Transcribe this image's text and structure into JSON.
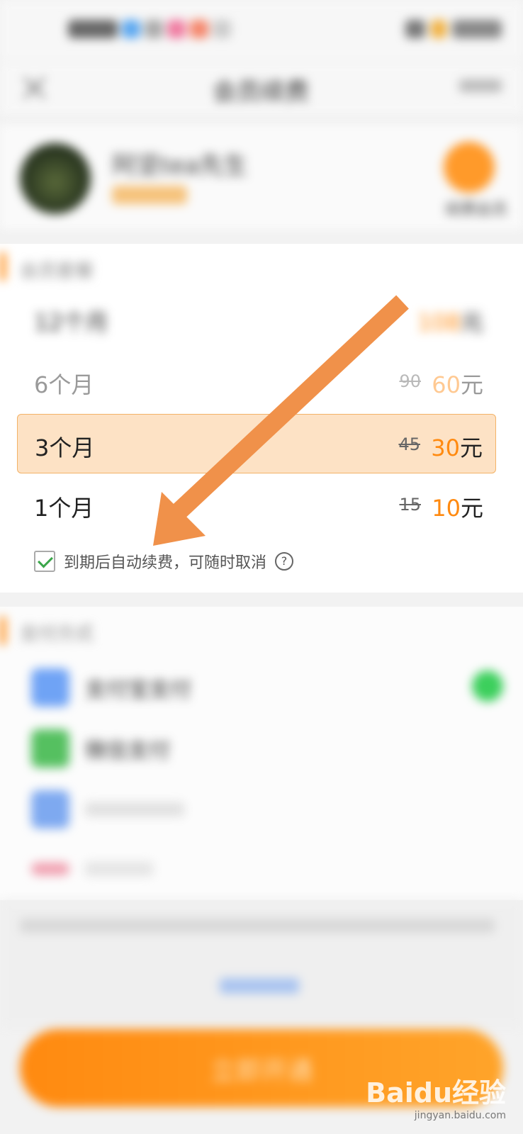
{
  "status_bar": {
    "time": "",
    "battery": ""
  },
  "nav": {
    "title": "会员续费"
  },
  "user": {
    "name": "阿坚tea先生",
    "vip_label": "续费会员"
  },
  "plans_section": {
    "title": "会员套餐",
    "plans": [
      {
        "name": "12个月",
        "original_price": "",
        "price": "108",
        "unit": "元",
        "selected": false
      },
      {
        "name": "6个月",
        "original_price": "90",
        "price": "60",
        "unit": "元",
        "selected": false
      },
      {
        "name": "3个月",
        "original_price": "45",
        "price": "30",
        "unit": "元",
        "selected": true
      },
      {
        "name": "1个月",
        "original_price": "15",
        "price": "10",
        "unit": "元",
        "selected": false
      }
    ],
    "auto_renew": {
      "checked": true,
      "label": "到期后自动续费，可随时取消",
      "help_icon": "?"
    }
  },
  "payment_section": {
    "title": "支付方式",
    "methods": [
      {
        "label": "支付宝支付",
        "icon": "alipay-icon",
        "color": "#6fa3f5"
      },
      {
        "label": "微信支付",
        "icon": "wechat-icon",
        "color": "#55c060"
      },
      {
        "label": "",
        "icon": "card-icon",
        "color": "#7ea9f0"
      },
      {
        "label": "",
        "icon": "bank-icon",
        "color": "#f0a0b0"
      }
    ]
  },
  "agreement": {
    "link": ""
  },
  "action": {
    "open_label": "立即开通"
  },
  "watermark": {
    "logo": "Baidu经验",
    "url": "jingyan.baidu.com"
  },
  "colors": {
    "accent": "#ff8a10",
    "selected_bg": "#fde2c5",
    "arrow": "#f0914a"
  }
}
